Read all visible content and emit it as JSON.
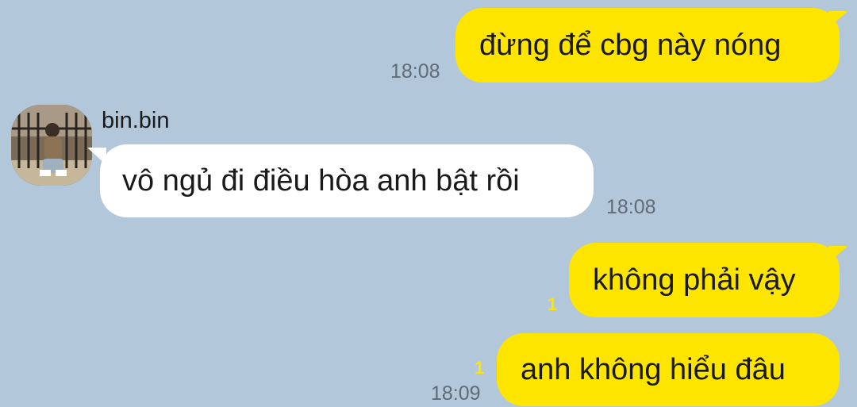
{
  "chat": {
    "messages": [
      {
        "direction": "out",
        "text": "đừng để cbg này nóng",
        "time": "18:08"
      },
      {
        "direction": "in",
        "sender": "bin.bin",
        "text": "vô ngủ đi điều hòa anh bật rồi",
        "time": "18:08"
      },
      {
        "direction": "out",
        "text": "không phải vậy",
        "unread": "1"
      },
      {
        "direction": "out",
        "text": "anh không hiểu đâu",
        "unread": "1",
        "time": "18:09"
      }
    ]
  },
  "colors": {
    "background": "#b2c7da",
    "outgoing_bubble": "#fee500",
    "incoming_bubble": "#ffffff",
    "unread_count": "#fee500"
  }
}
